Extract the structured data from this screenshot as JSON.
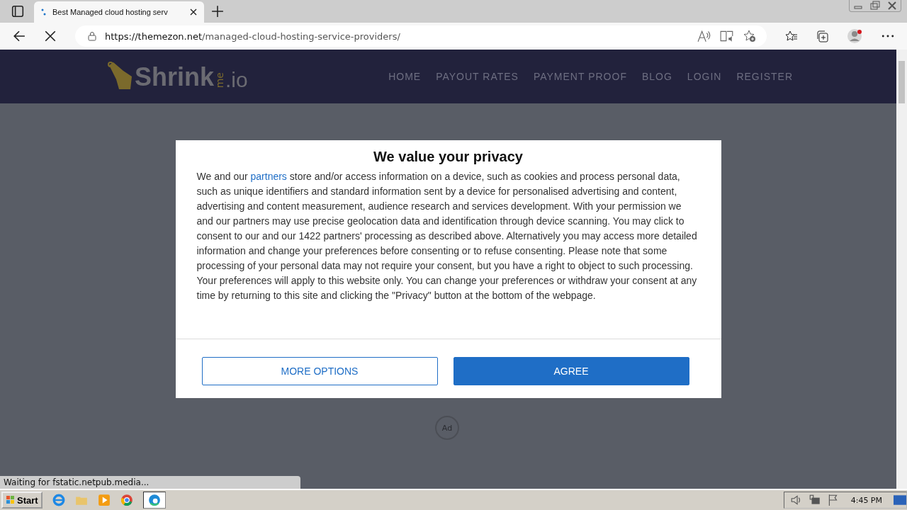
{
  "browser": {
    "tabs": [
      {
        "title": "Best Managed cloud hosting serv",
        "selected": true
      }
    ],
    "url_host": "https://themezon.net",
    "url_path": "/managed-cloud-hosting-service-providers/"
  },
  "site": {
    "logo": [
      "Shrink",
      "me",
      ".io"
    ],
    "nav": [
      "HOME",
      "PAYOUT RATES",
      "PAYMENT PROOF",
      "BLOG",
      "LOGIN",
      "REGISTER"
    ]
  },
  "consent": {
    "title": "We value your privacy",
    "text_before": "We and our ",
    "link": "partners",
    "text_after": " store and/or access information on a device, such as cookies and process personal data, such as unique identifiers and standard information sent by a device for personalised advertising and content, advertising and content measurement, audience research and services development. With your permission we and our partners may use precise geolocation data and identification through device scanning. You may click to consent to our and our 1422 partners' processing as described above. Alternatively you may access more detailed information and change your preferences before consenting or to refuse consenting. Please note that some processing of your personal data may not require your consent, but you have a right to object to such processing. Your preferences will apply to this website only. You can change your preferences or withdraw your consent at any time by returning to this site and clicking the \"Privacy\" button at the bottom of the webpage.",
    "buttons": [
      {
        "label": "MORE OPTIONS",
        "kind": "outline"
      },
      {
        "label": "AGREE",
        "kind": "primary"
      }
    ]
  },
  "ad_badge": "Ad",
  "status_text": "Waiting for fstatic.netpub.media...",
  "taskbar": {
    "start": "Start",
    "clock": "4:45 PM"
  }
}
